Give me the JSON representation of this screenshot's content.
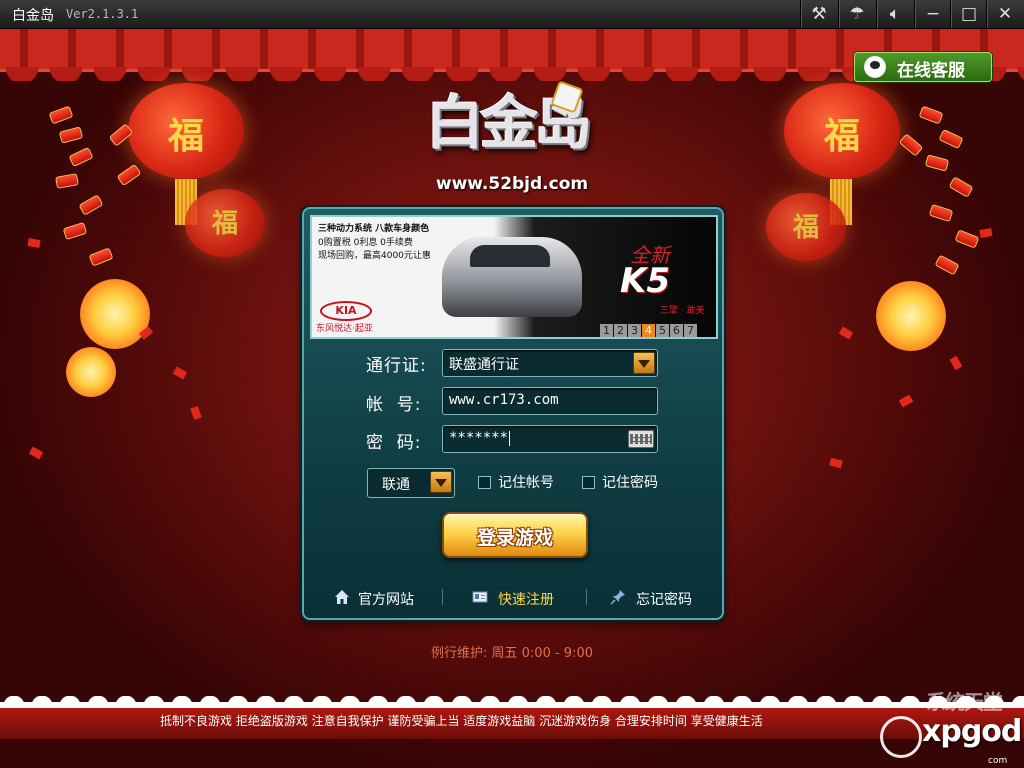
{
  "window": {
    "title": "白金岛",
    "version": "Ver2.1.3.1",
    "controls": [
      "tools-icon",
      "umbrella-icon",
      "speaker-icon",
      "minimize-icon",
      "maximize-icon",
      "close-icon"
    ]
  },
  "header": {
    "online_service_label": "在线客服",
    "logo_url": "www.52bjd.com"
  },
  "decor": {
    "lantern_char": "福"
  },
  "ad": {
    "line1": "三种动力系统 八款车身颜色",
    "line2": "0购置税 0利息 0手续费",
    "line3": "现场回购，最高4000元让惠",
    "brand": "KIA",
    "dealer": "东风悦达·起亚",
    "new_badge": "全新",
    "model": "K5",
    "slogan": "三擎 · 敢美",
    "pages": [
      "1",
      "2",
      "3",
      "4",
      "5",
      "6",
      "7"
    ],
    "active_page": "4"
  },
  "form": {
    "pass_label": "通行证:",
    "pass_value": "联盛通行证",
    "account_label": "帐  号:",
    "account_value": "www.cr173.com",
    "password_label": "密  码:",
    "password_value": "*******",
    "isp_value": "联通",
    "remember_account": "记住帐号",
    "remember_password": "记住密码",
    "login_button": "登录游戏"
  },
  "links": {
    "official_site": "官方网站",
    "quick_register": "快速注册",
    "forgot_password": "忘记密码"
  },
  "maintenance": "例行维护: 周五 0:00 - 9:00",
  "footer": "抵制不良游戏  拒绝盗版游戏  注意自我保护  谨防受骗上当  适度游戏益脑  沉迷游戏伤身  合理安排时间  享受健康生活",
  "watermark": {
    "top": "系统天堂",
    "main": "xpgod",
    "sub": "com"
  },
  "colors": {
    "accent_gold": "#ffd24a",
    "panel_teal": "#0e3a40",
    "background_red": "#6e120e",
    "online_green": "#3c8a1c"
  }
}
